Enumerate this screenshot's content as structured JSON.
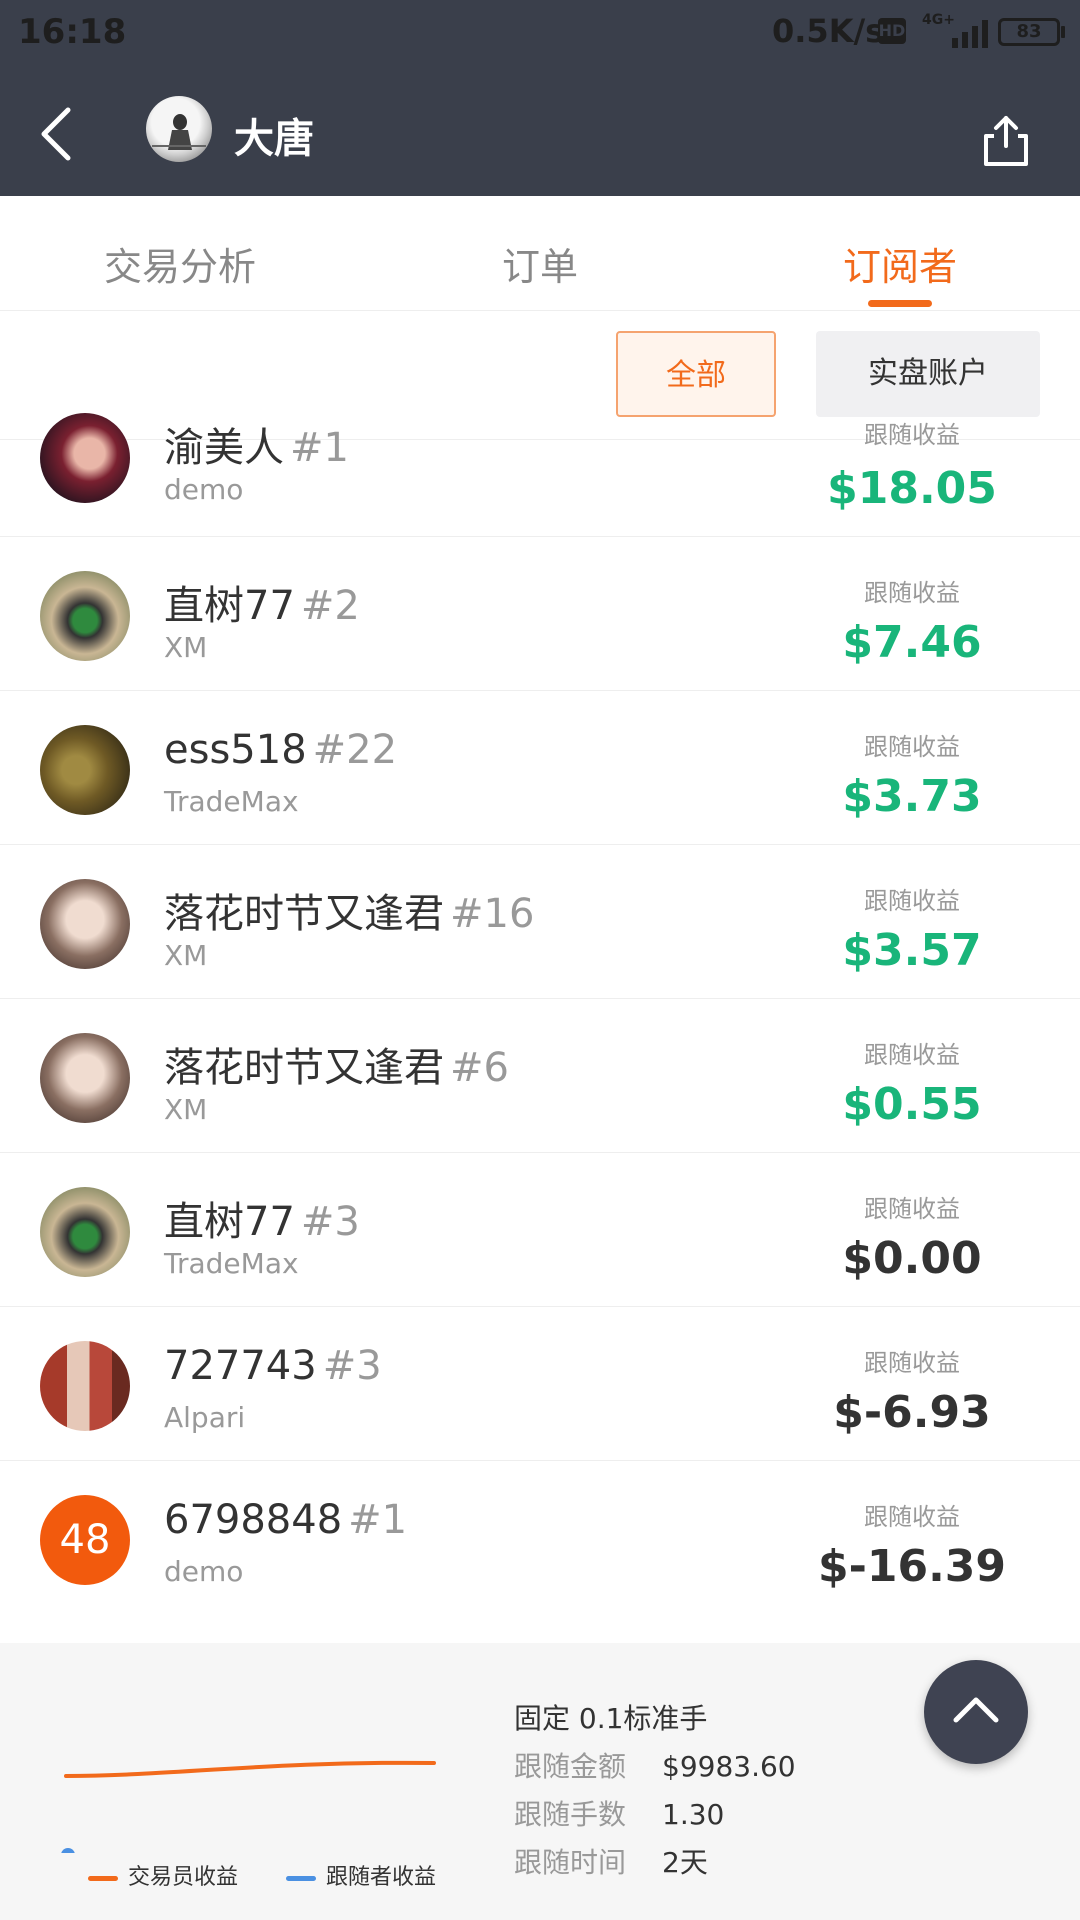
{
  "status_bar": {
    "time": "16:18",
    "network_speed": "0.5K/s",
    "hd": "HD",
    "network_type": "4G+",
    "battery": "83"
  },
  "header": {
    "title": "大唐",
    "back_icon": "chevron-left-icon",
    "share_icon": "share-icon"
  },
  "tabs": [
    {
      "label": "交易分析",
      "active": false
    },
    {
      "label": "订单",
      "active": false
    },
    {
      "label": "订阅者",
      "active": true
    }
  ],
  "filters": {
    "all": "全部",
    "real": "实盘账户"
  },
  "subscribers": [
    {
      "name": "渝美人",
      "rank": "#1",
      "broker": "demo",
      "profit_label": "跟随收益",
      "profit": "$18.05",
      "profit_state": "positive"
    },
    {
      "name": "直树77",
      "rank": "#2",
      "broker": "XM",
      "profit_label": "跟随收益",
      "profit": "$7.46",
      "profit_state": "positive"
    },
    {
      "name": "ess518",
      "rank": "#22",
      "broker": "TradeMax",
      "profit_label": "跟随收益",
      "profit": "$3.73",
      "profit_state": "positive"
    },
    {
      "name": "落花时节又逢君",
      "rank": "#16",
      "broker": "XM",
      "profit_label": "跟随收益",
      "profit": "$3.57",
      "profit_state": "positive"
    },
    {
      "name": "落花时节又逢君",
      "rank": "#6",
      "broker": "XM",
      "profit_label": "跟随收益",
      "profit": "$0.55",
      "profit_state": "positive"
    },
    {
      "name": "直树77",
      "rank": "#3",
      "broker": "TradeMax",
      "profit_label": "跟随收益",
      "profit": "$0.00",
      "profit_state": "zero"
    },
    {
      "name": "727743",
      "rank": "#3",
      "broker": "Alpari",
      "profit_label": "跟随收益",
      "profit": "$-6.93",
      "profit_state": "negative"
    },
    {
      "name": "6798848",
      "rank": "#1",
      "broker": "demo",
      "profit_label": "跟随收益",
      "profit": "$-16.39",
      "profit_state": "negative",
      "avatar_text": "48"
    }
  ],
  "summary": {
    "mode": "固定 0.1标准手",
    "amount_label": "跟随金额",
    "amount": "$9983.60",
    "lots_label": "跟随手数",
    "lots": "1.30",
    "time_label": "跟随时间",
    "time": "2天",
    "legend_trader": "交易员收益",
    "legend_follower": "跟随者收益"
  },
  "colors": {
    "accent": "#f26a1b",
    "positive": "#19b57a",
    "follower_line": "#4a90e2",
    "header_bg": "#3a3f4b"
  },
  "scroll_top_icon": "chevron-up-icon"
}
